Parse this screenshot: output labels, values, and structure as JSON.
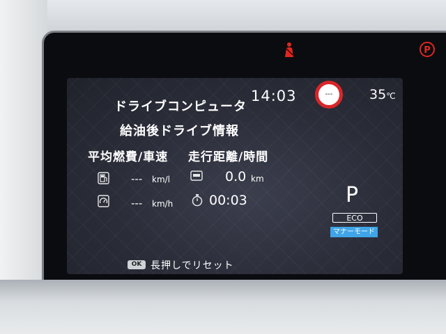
{
  "header": {
    "title": "ドライブコンピュータ",
    "clock": "14:03",
    "temperature": "35",
    "temperature_unit": "℃"
  },
  "speed_limit": {
    "value": "---",
    "color": "#d8262a"
  },
  "screen": {
    "subtitle": "給油後ドライブ情報"
  },
  "columns": {
    "left_label": "平均燃費/車速",
    "right_label": "走行距離/時間"
  },
  "metrics": {
    "fuel_economy": {
      "value": "---",
      "unit": "km/l",
      "icon": "fuel-pump-icon"
    },
    "average_speed": {
      "value": "---",
      "unit": "km/h",
      "icon": "speedometer-icon"
    },
    "distance": {
      "value": "0.0",
      "unit": "km",
      "icon": "odometer-icon"
    },
    "time": {
      "value": "00:03",
      "icon": "stopwatch-icon"
    }
  },
  "drive": {
    "gear": "P",
    "eco_label": "ECO",
    "manner_mode_label": "マナーモード",
    "manner_color": "#3fa5e8"
  },
  "footer": {
    "button_label": "OK",
    "hint": "長押しでリセット"
  },
  "indicators": {
    "seatbelt_icon": "seatbelt-warning-icon",
    "parking_icon": "parking-brake-icon",
    "parking_symbol": "P",
    "warning_color": "#e0281f"
  }
}
